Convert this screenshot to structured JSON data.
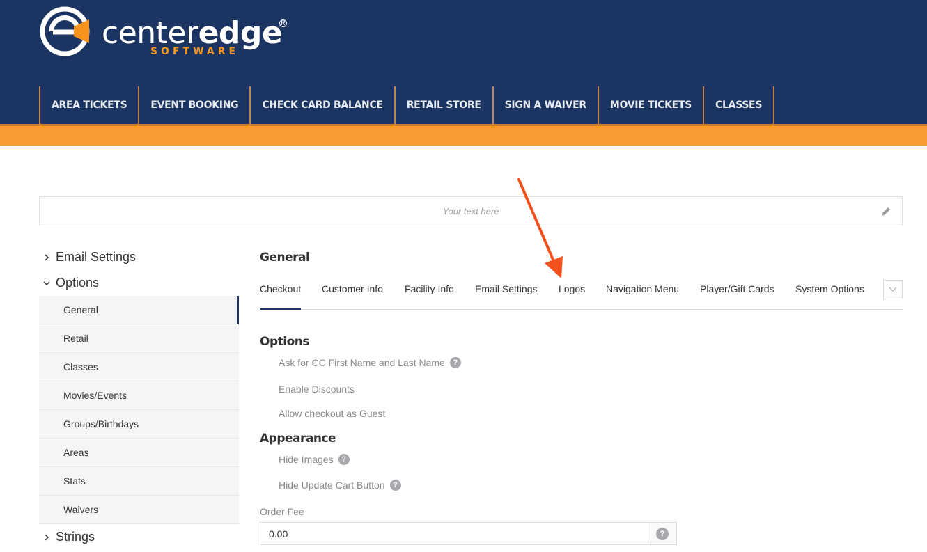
{
  "brand": {
    "name_light": "center",
    "name_bold": "edge",
    "registered": "R",
    "sub": "SOFTWARE",
    "logo_icon": "centeredge-logo-icon",
    "colors": {
      "navy": "#1b3461",
      "orange": "#fa9a32",
      "orange_text": "#f7941e"
    }
  },
  "topnav": [
    {
      "label": "AREA TICKETS"
    },
    {
      "label": "EVENT BOOKING"
    },
    {
      "label": "CHECK CARD BALANCE"
    },
    {
      "label": "RETAIL STORE"
    },
    {
      "label": "SIGN A WAIVER"
    },
    {
      "label": "MOVIE TICKETS"
    },
    {
      "label": "CLASSES"
    }
  ],
  "editable_text": {
    "placeholder": "Your text here",
    "icon": "pencil-icon"
  },
  "sidebar": {
    "groups": [
      {
        "label": "Email Settings",
        "icon": "chevron-right-icon"
      },
      {
        "label": "Options",
        "icon": "chevron-down-icon"
      },
      {
        "label": "Strings",
        "icon": "chevron-right-icon"
      }
    ],
    "options_items": [
      {
        "label": "General",
        "active": true
      },
      {
        "label": "Retail"
      },
      {
        "label": "Classes"
      },
      {
        "label": "Movies/Events"
      },
      {
        "label": "Groups/Birthdays"
      },
      {
        "label": "Areas"
      },
      {
        "label": "Stats"
      },
      {
        "label": "Waivers"
      }
    ]
  },
  "main": {
    "title": "General",
    "tabs": [
      {
        "label": "Checkout",
        "active": true
      },
      {
        "label": "Customer Info"
      },
      {
        "label": "Facility Info"
      },
      {
        "label": "Email Settings"
      },
      {
        "label": "Logos"
      },
      {
        "label": "Navigation Menu"
      },
      {
        "label": "Player/Gift Cards"
      },
      {
        "label": "System Options"
      }
    ],
    "more_icon": "chevron-down-icon",
    "sections": {
      "options": {
        "title": "Options",
        "items": [
          {
            "label": "Ask for CC First Name and Last Name",
            "help": "?"
          },
          {
            "label": "Enable Discounts"
          },
          {
            "label": "Allow checkout as Guest"
          }
        ]
      },
      "appearance": {
        "title": "Appearance",
        "items": [
          {
            "label": "Hide Images",
            "help": "?"
          },
          {
            "label": "Hide Update Cart Button",
            "help": "?"
          }
        ]
      }
    },
    "order_fee": {
      "label": "Order Fee",
      "value": "0.00",
      "help": "?"
    }
  },
  "annotation": {
    "icon": "red-arrow-icon",
    "color": "#f4511e"
  }
}
